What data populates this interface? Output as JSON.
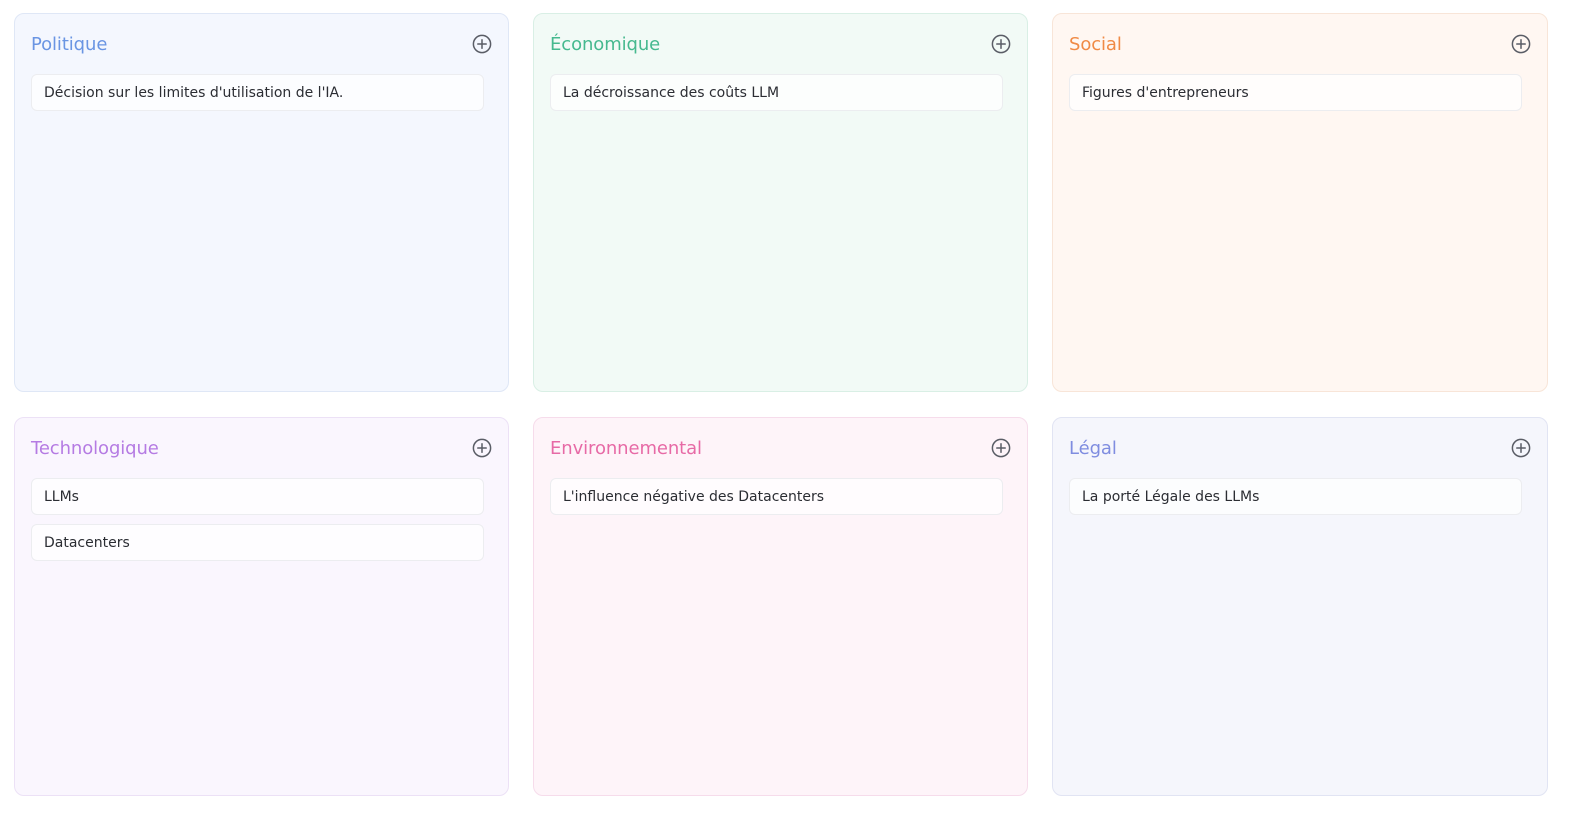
{
  "panels": [
    {
      "title": "Politique",
      "color": "#6a95e3",
      "bg": "#f4f7fe",
      "border": "#dfe7f6",
      "add_icon": "plus-circle-icon",
      "items": [
        "Décision sur les limites d'utilisation de l'IA."
      ]
    },
    {
      "title": "Économique",
      "color": "#46b98f",
      "bg": "#f2faf6",
      "border": "#d9efe5",
      "add_icon": "plus-circle-icon",
      "items": [
        "La décroissance des coûts LLM"
      ]
    },
    {
      "title": "Social",
      "color": "#f08a45",
      "bg": "#fff7f2",
      "border": "#f8e5d8",
      "add_icon": "plus-circle-icon",
      "items": [
        "Figures d'entrepreneurs"
      ]
    },
    {
      "title": "Technologique",
      "color": "#b57be3",
      "bg": "#faf6fe",
      "border": "#ece1f6",
      "add_icon": "plus-circle-icon",
      "items": [
        "LLMs",
        "Datacenters"
      ]
    },
    {
      "title": "Environnemental",
      "color": "#e76aa6",
      "bg": "#fef4f9",
      "border": "#f6dceb",
      "add_icon": "plus-circle-icon",
      "items": [
        "L'influence négative des Datacenters"
      ]
    },
    {
      "title": "Légal",
      "color": "#7f8de0",
      "bg": "#f5f6fc",
      "border": "#e1e4f3",
      "add_icon": "plus-circle-icon",
      "items": [
        "La porté Légale des LLMs"
      ]
    }
  ]
}
